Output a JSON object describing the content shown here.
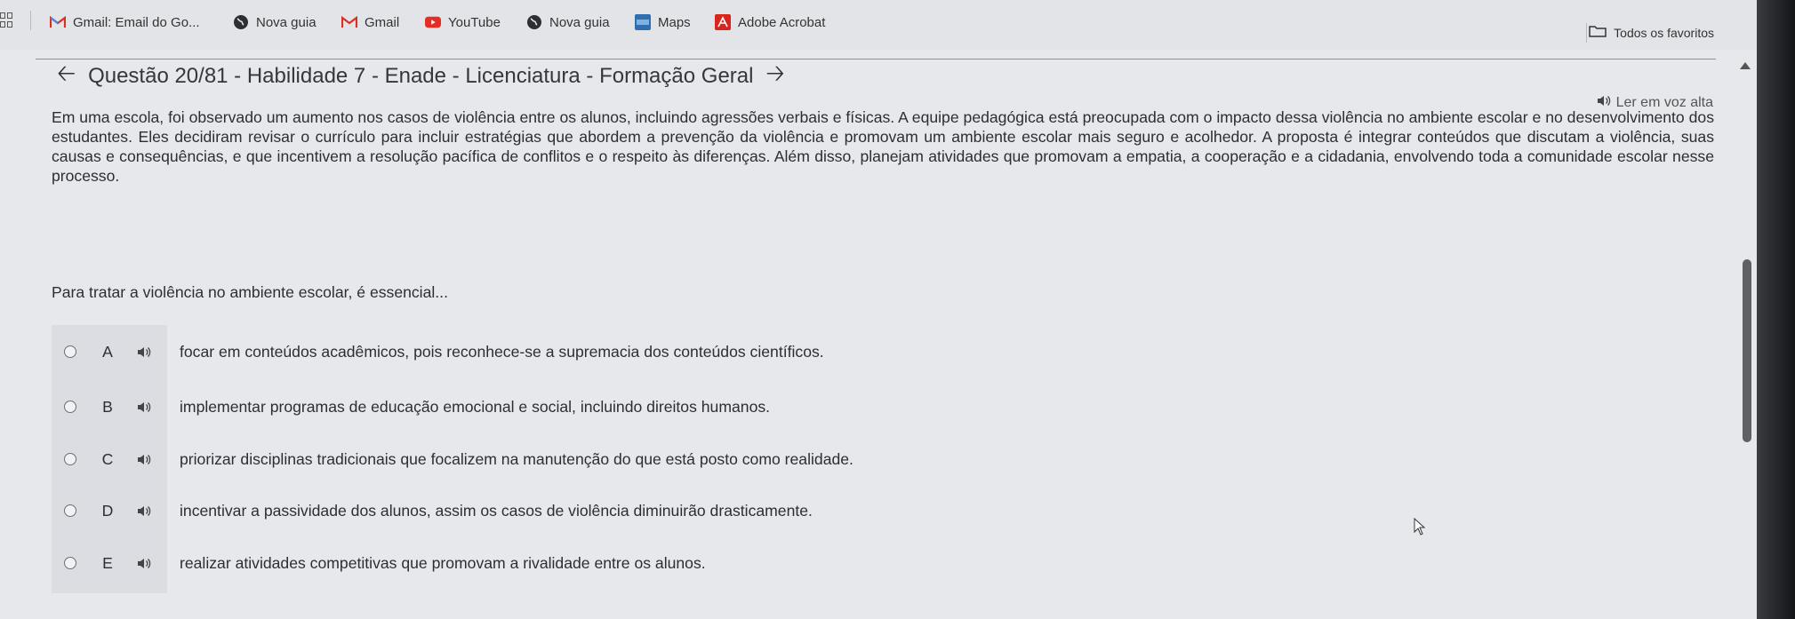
{
  "bookmarks": [
    {
      "label": "Gmail: Email do Go...",
      "icon": "gmail-icon"
    },
    {
      "label": "Nova guia",
      "icon": "globe-icon"
    },
    {
      "label": "Gmail",
      "icon": "gmail-icon"
    },
    {
      "label": "YouTube",
      "icon": "youtube-icon"
    },
    {
      "label": "Nova guia",
      "icon": "globe-icon"
    },
    {
      "label": "Maps",
      "icon": "maps-icon"
    },
    {
      "label": "Adobe Acrobat",
      "icon": "acrobat-icon"
    }
  ],
  "favorites_label": "Todos os favoritos",
  "header": {
    "title": "Questão 20/81 - Habilidade 7 - Enade - Licenciatura - Formação Geral"
  },
  "read_aloud_label": "Ler em voz alta",
  "statement": "Em uma escola, foi observado um aumento nos casos de violência entre os alunos, incluindo agressões verbais e físicas. A equipe pedagógica está preocupada com o impacto dessa violência no ambiente escolar e no desenvolvimento dos estudantes. Eles decidiram revisar o currículo para incluir estratégias que abordem a prevenção da violência e promovam um ambiente escolar mais seguro e acolhedor. A proposta é integrar conteúdos que discutam a violência, suas causas e consequências, e que incentivem a resolução pacífica de conflitos e o respeito às diferenças. Além disso, planejam atividades que promovam a empatia, a cooperação e a cidadania, envolvendo toda a comunidade escolar nesse processo.",
  "question": "Para tratar a violência no ambiente escolar, é essencial...",
  "options": [
    {
      "letter": "A",
      "text": "focar em conteúdos acadêmicos, pois reconhece-se a supremacia dos conteúdos científicos."
    },
    {
      "letter": "B",
      "text": "implementar programas de educação emocional e social, incluindo direitos humanos."
    },
    {
      "letter": "C",
      "text": "priorizar disciplinas tradicionais que focalizem na manutenção do que está posto como realidade."
    },
    {
      "letter": "D",
      "text": "incentivar a passividade dos alunos, assim os casos de violência diminuirão drasticamente."
    },
    {
      "letter": "E",
      "text": "realizar atividades competitivas que promovam a rivalidade entre os alunos."
    }
  ],
  "colors": {
    "background": "#e7e8ec",
    "text": "#2c2e33",
    "gmail_red": "#d93025",
    "youtube_red": "#e52d27",
    "acrobat_red": "#d7261e"
  }
}
